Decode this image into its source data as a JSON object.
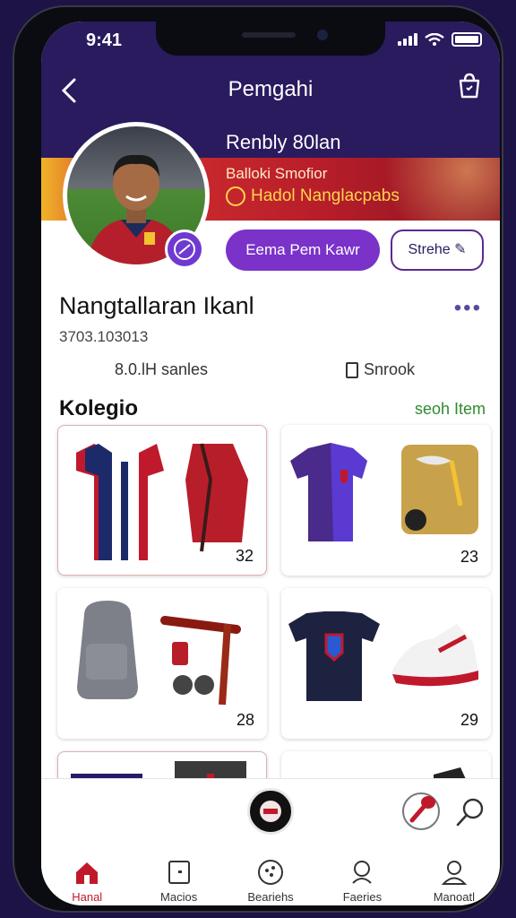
{
  "status": {
    "time": "9:41"
  },
  "nav": {
    "title": "Pemgahi"
  },
  "profile": {
    "name": "Renbly 80lan",
    "banner_line1": "Balloki Smofior",
    "banner_line2": "Hadol Nanglacpabs"
  },
  "buttons": {
    "primary": "Eema Pem Kawr",
    "secondary": "Strehe"
  },
  "shop": {
    "name": "Nangtallaran Ikanl",
    "id": "3703.103013",
    "sales": "8.0.lH sanles",
    "sold": "Snrook"
  },
  "section": {
    "title": "Kolegio",
    "link": "seoh Item"
  },
  "products": [
    {
      "count": "32",
      "items": [
        "red-navy jersey",
        "red backpack"
      ]
    },
    {
      "count": "23",
      "items": [
        "purple jersey",
        "shoe kit"
      ]
    },
    {
      "count": "28",
      "items": [
        "grey backpack",
        "training gear"
      ]
    },
    {
      "count": "29",
      "items": [
        "navy t-shirt",
        "sneakers"
      ]
    }
  ],
  "tabs": [
    {
      "label": "Hanal",
      "icon": "home-icon",
      "active": true
    },
    {
      "label": "Macios",
      "icon": "square-icon",
      "active": false
    },
    {
      "label": "Beariehs",
      "icon": "ball-icon",
      "active": false
    },
    {
      "label": "Faeries",
      "icon": "location-icon",
      "active": false
    },
    {
      "label": "Manoatl",
      "icon": "person-icon",
      "active": false
    }
  ],
  "colors": {
    "header": "#2a1a5e",
    "accent": "#7a32c9",
    "active_tab": "#c0192c",
    "link": "#2f8a2f"
  }
}
